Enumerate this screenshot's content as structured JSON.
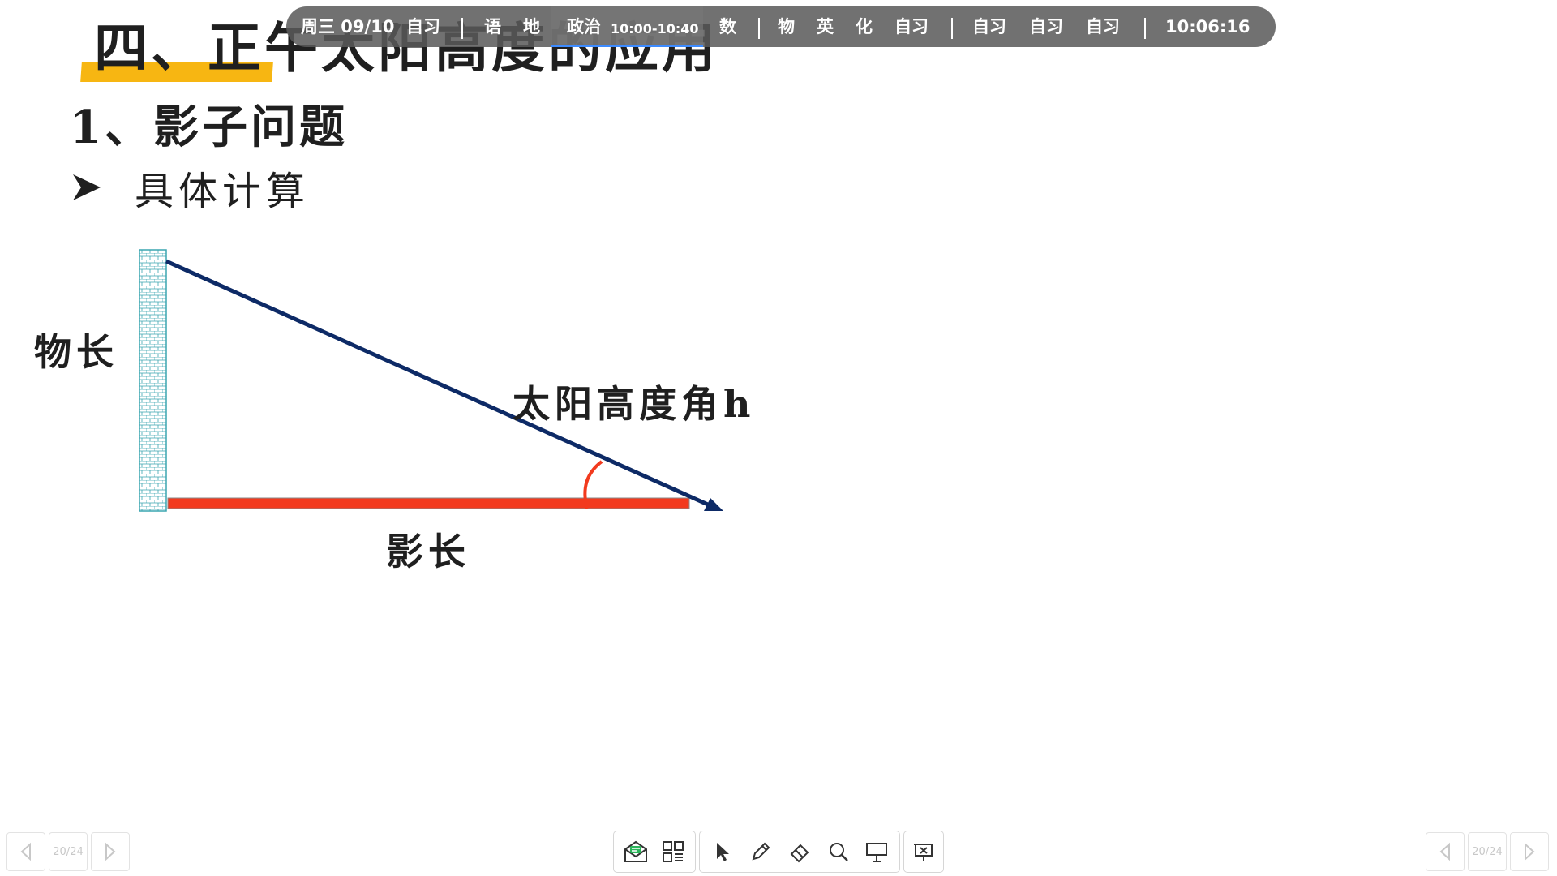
{
  "slide": {
    "title": "四、正午太阳高度的应用",
    "subtitle": "1、影子问题",
    "bullet": "具体计算"
  },
  "diagram": {
    "object_length_label": "物长",
    "sun_angle_label": "太阳高度角h",
    "shadow_length_label": "影长",
    "colors": {
      "sun_ray": "#0d2a66",
      "shadow": "#f23a1e",
      "angle_arc": "#f23a1e",
      "wall_stroke": "#3aa5b0"
    }
  },
  "schedule": {
    "date": "周三 09/10",
    "items": [
      {
        "label": "自习"
      },
      {
        "label": "语"
      },
      {
        "label": "地"
      },
      {
        "label": "政治"
      },
      {
        "label": "数"
      },
      {
        "label": "物"
      },
      {
        "label": "英"
      },
      {
        "label": "化"
      },
      {
        "label": "自习"
      },
      {
        "label": "自习"
      },
      {
        "label": "自习"
      },
      {
        "label": "自习"
      }
    ],
    "current_time_range": "10:00-10:40",
    "clock": "10:06:16"
  },
  "navigation": {
    "page_indicator": "20/24"
  },
  "toolbar": {
    "tools": [
      {
        "name": "inbox-icon"
      },
      {
        "name": "apps-grid-icon"
      },
      {
        "name": "pointer-icon"
      },
      {
        "name": "pen-icon"
      },
      {
        "name": "eraser-icon"
      },
      {
        "name": "zoom-icon"
      },
      {
        "name": "whiteboard-icon"
      },
      {
        "name": "exit-presentation-icon"
      }
    ]
  }
}
